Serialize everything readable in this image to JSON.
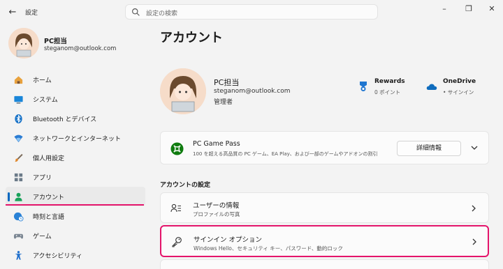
{
  "window": {
    "title": "設定",
    "back_icon": "back-arrow-icon",
    "controls": [
      "minimize-icon",
      "maximize-icon",
      "close-icon"
    ]
  },
  "search": {
    "placeholder": "設定の検索",
    "icon": "search-icon"
  },
  "user": {
    "name": "PC担当",
    "email": "steganom@outlook.com"
  },
  "sidebar": {
    "items": [
      {
        "label": "ホーム",
        "icon": "home-icon"
      },
      {
        "label": "システム",
        "icon": "system-icon"
      },
      {
        "label": "Bluetooth とデバイス",
        "icon": "bluetooth-icon"
      },
      {
        "label": "ネットワークとインターネット",
        "icon": "network-icon"
      },
      {
        "label": "個人用設定",
        "icon": "personalization-icon"
      },
      {
        "label": "アプリ",
        "icon": "apps-icon"
      },
      {
        "label": "アカウント",
        "icon": "account-icon",
        "active": true
      },
      {
        "label": "時刻と言語",
        "icon": "time-language-icon"
      },
      {
        "label": "ゲーム",
        "icon": "gaming-icon"
      },
      {
        "label": "アクセシビリティ",
        "icon": "accessibility-icon"
      }
    ]
  },
  "main": {
    "title": "アカウント",
    "account": {
      "name": "PC担当",
      "email": "steganom@outlook.com",
      "role": "管理者"
    },
    "services": [
      {
        "name": "Rewards",
        "sub": "0 ポイント",
        "icon": "rewards-icon"
      },
      {
        "name": "OneDrive",
        "sub": "• サインイン",
        "icon": "onedrive-icon"
      }
    ],
    "game_pass": {
      "title": "PC Game Pass",
      "description": "100 を超える高品質の PC ゲーム、EA Play、および一部のゲームやアドオンの割引",
      "button": "詳細情報",
      "icon": "xbox-icon"
    },
    "section_label": "アカウントの設定",
    "rows": [
      {
        "title": "ユーザーの情報",
        "sub": "プロファイルの写真",
        "icon": "user-info-icon"
      },
      {
        "title": "サインイン オプション",
        "sub": "Windows Hello、セキュリティ キー、パスワード、動的ロック",
        "icon": "key-icon",
        "highlighted": true
      }
    ]
  },
  "colors": {
    "accent": "#0067c0",
    "highlight": "#e4146b",
    "xbox": "#107c10"
  }
}
